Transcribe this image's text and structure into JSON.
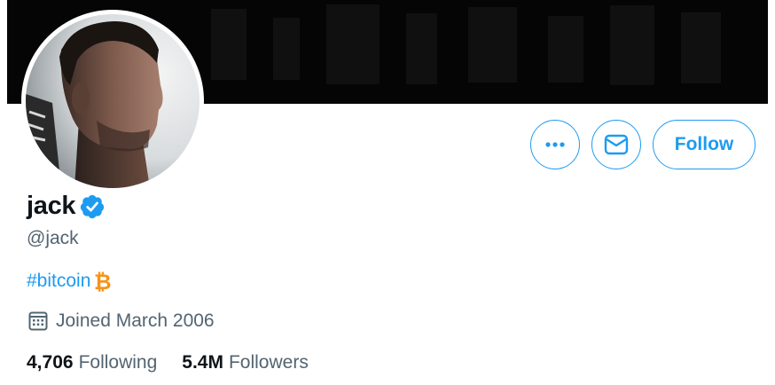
{
  "profile": {
    "display_name": "jack",
    "handle": "@jack",
    "bio_hashtag": "#bitcoin",
    "bitcoin_glyph": "₿",
    "joined": "Joined March 2006",
    "following_count": "4,706",
    "following_label": "Following",
    "followers_count": "5.4M",
    "followers_label": "Followers"
  },
  "actions": {
    "more_icon": "more-horizontal-icon",
    "message_icon": "envelope-icon",
    "follow_label": "Follow"
  },
  "icons": {
    "verified": "verified-badge-icon",
    "calendar": "calendar-icon"
  },
  "colors": {
    "accent": "#1d9bf0",
    "text_primary": "#0f1419",
    "text_secondary": "#536471",
    "bitcoin": "#f7931a",
    "banner": "#050505"
  }
}
